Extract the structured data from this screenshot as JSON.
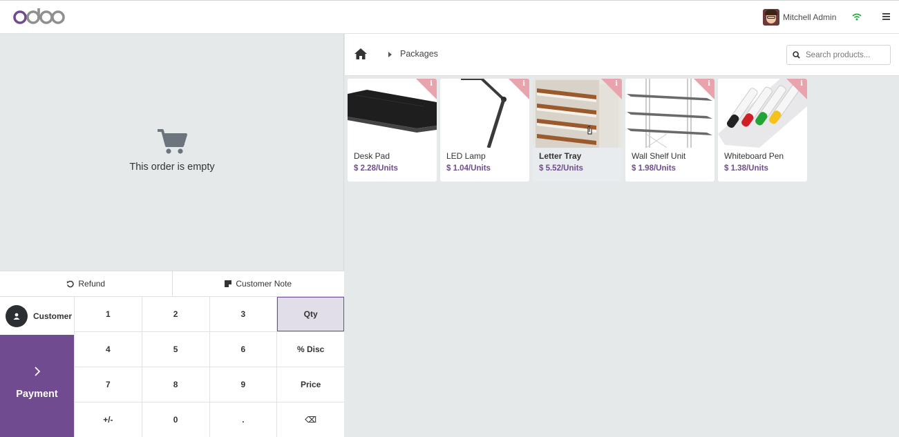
{
  "topbar": {
    "logo_text": "odoo",
    "user_name": "Mitchell Admin"
  },
  "order": {
    "empty_text": "This order is empty"
  },
  "actions": {
    "refund_label": "Refund",
    "note_label": "Customer Note"
  },
  "customer": {
    "label": "Customer"
  },
  "payment": {
    "label": "Payment"
  },
  "numpad": {
    "keys": [
      "1",
      "2",
      "3",
      "Qty",
      "4",
      "5",
      "6",
      "% Disc",
      "7",
      "8",
      "9",
      "Price",
      "+/-",
      "0",
      ".",
      "⌫"
    ],
    "active_key": "Qty"
  },
  "breadcrumb": {
    "category": "Packages"
  },
  "search": {
    "placeholder": "Search products..."
  },
  "products": [
    {
      "name": "Desk Pad",
      "price": "$ 2.28/Units"
    },
    {
      "name": "LED Lamp",
      "price": "$ 1.04/Units"
    },
    {
      "name": "Letter Tray",
      "price": "$ 5.52/Units"
    },
    {
      "name": "Wall Shelf Unit",
      "price": "$ 1.98/Units"
    },
    {
      "name": "Whiteboard Pen",
      "price": "$ 1.38/Units"
    }
  ],
  "colors": {
    "brand": "#714b90",
    "active_key_bg": "#e1dde9",
    "info_ribbon": "#e8a3ad"
  }
}
